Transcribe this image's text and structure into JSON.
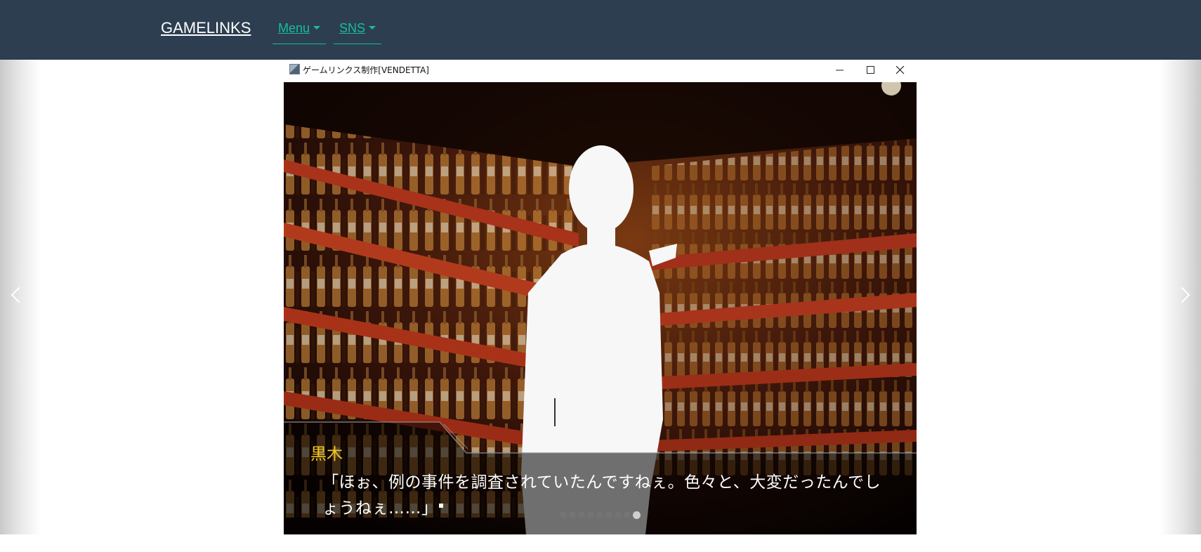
{
  "navbar": {
    "brand": "GAMELINKS",
    "menu_label": "Menu",
    "sns_label": "SNS",
    "bg_color": "#2c3e50",
    "link_color": "#18bc9c"
  },
  "carousel": {
    "window": {
      "title": "ゲームリンクス制作[VENDETTA]",
      "icon": "app-window-icon",
      "controls": [
        "minimize-icon",
        "maximize-icon",
        "close-icon"
      ]
    },
    "game": {
      "speaker": "黒木",
      "line1": "「ほぉ、例の事件を調査されていたんですねぇ。色々と、大変だったんでし",
      "line2": "ょうねぇ……」",
      "speaker_color": "#f5c518"
    },
    "indicators": {
      "total": 9,
      "active_index": 8
    },
    "prev_icon": "chevron-left-icon",
    "next_icon": "chevron-right-icon"
  }
}
